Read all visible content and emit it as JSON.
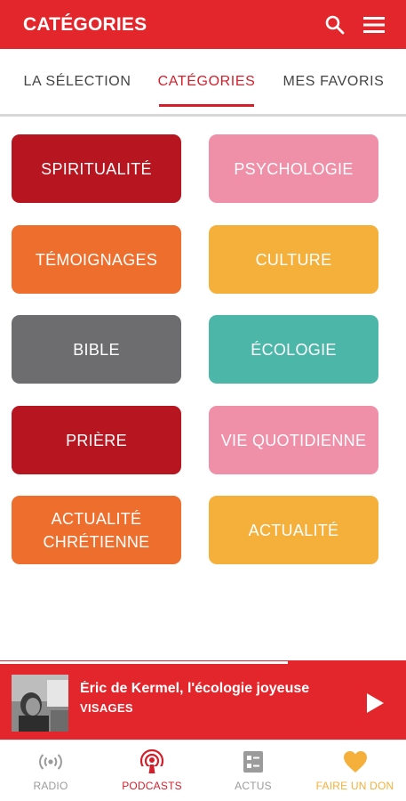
{
  "appbar": {
    "title": "CATÉGORIES"
  },
  "tabs": [
    {
      "label": "LA SÉLECTION",
      "active": false
    },
    {
      "label": "CATÉGORIES",
      "active": true
    },
    {
      "label": "MES FAVORIS",
      "active": false
    }
  ],
  "categories": [
    {
      "label": "SPIRITUALITÉ",
      "color": "#b7151f"
    },
    {
      "label": "PSYCHOLOGIE",
      "color": "#ef8fa8"
    },
    {
      "label": "TÉMOIGNAGES",
      "color": "#ee6f2d"
    },
    {
      "label": "CULTURE",
      "color": "#f4b03b"
    },
    {
      "label": "BIBLE",
      "color": "#6d6d6f"
    },
    {
      "label": "ÉCOLOGIE",
      "color": "#4cb7a9"
    },
    {
      "label": "PRIÈRE",
      "color": "#b7151f"
    },
    {
      "label": "VIE QUOTIDIENNE",
      "color": "#ef8fa8"
    },
    {
      "label": "ACTUALITÉ CHRÉTIENNE",
      "color": "#ee6f2d"
    },
    {
      "label": "ACTUALITÉ",
      "color": "#f4b03b"
    }
  ],
  "player": {
    "title": "Éric de Kermel, l'écologie joyeuse",
    "subtitle": "VISAGES",
    "progress": 0.71
  },
  "nav": [
    {
      "label": "RADIO",
      "icon": "radio-icon",
      "color": "#9b9b9b"
    },
    {
      "label": "PODCASTS",
      "icon": "podcast-icon",
      "color": "#d41f2b"
    },
    {
      "label": "ACTUS",
      "icon": "news-icon",
      "color": "#9b9b9b"
    },
    {
      "label": "FAIRE UN DON",
      "icon": "heart-icon",
      "color": "#f4b03b"
    }
  ],
  "colors": {
    "brand_red": "#e3262b",
    "active_tab": "#d41f2b"
  }
}
